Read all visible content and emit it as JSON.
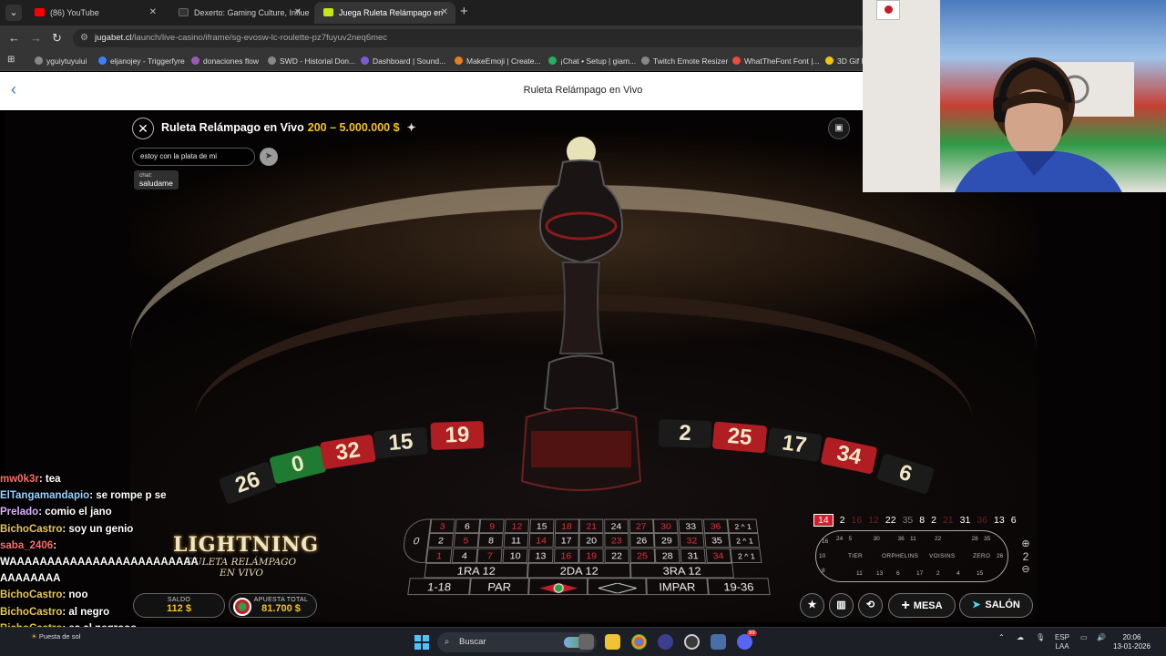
{
  "browser": {
    "tabs": [
      {
        "label": "(86) YouTube",
        "active": false,
        "color": "#ff0000"
      },
      {
        "label": "Dexerto: Gaming Culture, Influe",
        "active": false,
        "color": "#333333"
      },
      {
        "label": "Juega Ruleta Relámpago en",
        "active": true,
        "color": "#c6e817"
      }
    ],
    "url": "jugabet.cl",
    "url_rest": "/launch/live-casino/iframe/sg-evosw-lc-roulette-pz7fuyuv2neq6mec",
    "bookmarks": [
      "yguiytuyuiui",
      "eljanojey - Triggerfyre",
      "donaciones flow",
      "SWD - Historial Don...",
      "Dashboard | Sound...",
      "MakeEmoji | Create...",
      "¡Chat • Setup | giam...",
      "Twitch Emote Resizer",
      "WhatTheFont Font |...",
      "3D Gif M"
    ]
  },
  "page": {
    "header_title": "Ruleta Relámpago en Vivo"
  },
  "game": {
    "title": "Ruleta Relámpago en Vivo",
    "limits": "200 – 5.000.000 $",
    "chat_input_value": "estoy con la plata de mi",
    "chat_label": "chat:",
    "chat_message": "saludame",
    "wheel_pockets": [
      "26",
      "0",
      "32",
      "15",
      "19",
      "2",
      "25",
      "17",
      "34",
      "6"
    ],
    "bet_rows": [
      [
        "3",
        "6",
        "9",
        "12",
        "15",
        "18",
        "21",
        "24",
        "27",
        "30",
        "33",
        "36"
      ],
      [
        "2",
        "5",
        "8",
        "11",
        "14",
        "17",
        "20",
        "23",
        "26",
        "29",
        "32",
        "35"
      ],
      [
        "1",
        "4",
        "7",
        "10",
        "13",
        "16",
        "19",
        "22",
        "25",
        "28",
        "31",
        "34"
      ]
    ],
    "red_numbers": [
      "3",
      "9",
      "12",
      "18",
      "21",
      "27",
      "30",
      "36",
      "5",
      "14",
      "23",
      "32",
      "1",
      "7",
      "16",
      "19",
      "25",
      "34"
    ],
    "zero": "0",
    "column_label": "2 ^ 1",
    "dozens": [
      "1RA 12",
      "2DA 12",
      "3RA 12"
    ],
    "outside": [
      "1-18",
      "PAR",
      "",
      "",
      "IMPAR",
      "19-36"
    ],
    "logo_main": "LIGHTNING",
    "logo_sub1": "RULETA RELÁMPAGO",
    "logo_sub2": "EN VIVO",
    "balance_label": "SALDO",
    "balance_value": "112 $",
    "total_bet_label": "APUESTA TOTAL",
    "total_bet_value": "81.700 $",
    "history": [
      {
        "n": "14",
        "c": "red",
        "first": true
      },
      {
        "n": "2",
        "c": "black"
      },
      {
        "n": "16",
        "c": "red",
        "dim": true
      },
      {
        "n": "12",
        "c": "red",
        "dim": true
      },
      {
        "n": "22",
        "c": "black"
      },
      {
        "n": "35",
        "c": "black",
        "dim": true
      },
      {
        "n": "8",
        "c": "black"
      },
      {
        "n": "2",
        "c": "black"
      },
      {
        "n": "21",
        "c": "red",
        "dim": true
      },
      {
        "n": "31",
        "c": "black"
      },
      {
        "n": "36",
        "c": "red",
        "dim": true
      },
      {
        "n": "13",
        "c": "black"
      },
      {
        "n": "6",
        "c": "black"
      }
    ],
    "racetrack_sections": [
      "TIER",
      "ORPHELINS",
      "VOISINS",
      "ZERO"
    ],
    "racetrack_top": [
      "24",
      "5",
      "",
      "30",
      "",
      "36",
      "11",
      "",
      "22",
      "",
      "",
      "28",
      "35"
    ],
    "racetrack_bottom": [
      "",
      "11",
      "13",
      "6",
      "17",
      "2",
      "4",
      "15"
    ],
    "racetrack_left": [
      "16",
      "10",
      "8"
    ],
    "racetrack_right": "26",
    "neighbours_value": "2",
    "mesa_label": "MESA",
    "salon_label": "SALÓN"
  },
  "twitch_chat": [
    {
      "user": "mw0k3r",
      "msg": "tea",
      "color": "r",
      "partial": true
    },
    {
      "user": "ElTangamandapio",
      "msg": "se rompe p se",
      "color": "b"
    },
    {
      "user": "Prelado",
      "msg": "comio el jano",
      "color": "p"
    },
    {
      "user": "BichoCastro",
      "msg": "soy un genio",
      "color": ""
    },
    {
      "user": "saba_2406",
      "msg": "",
      "color": "r"
    },
    {
      "user": "",
      "msg": "WAAAAAAAAAAAAAAAAAAAAAAAAA",
      "color": ""
    },
    {
      "user": "",
      "msg": "AAAAAAAA",
      "color": ""
    },
    {
      "user": "BichoCastro",
      "msg": "noo",
      "color": ""
    },
    {
      "user": "BichoCastro",
      "msg": "al negro",
      "color": ""
    },
    {
      "user": "BichoCastro",
      "msg": "es al negrooo",
      "color": ""
    }
  ],
  "taskbar": {
    "weather": "Puesta de sol",
    "search": "Buscar",
    "lang1": "ESP",
    "lang2": "LAA",
    "time": "20:06",
    "date": "13-01-2026",
    "badge": "99"
  },
  "colors": {
    "gold": "#f5c518",
    "red": "#e0323a",
    "accent_blue": "#3a6fd8"
  }
}
